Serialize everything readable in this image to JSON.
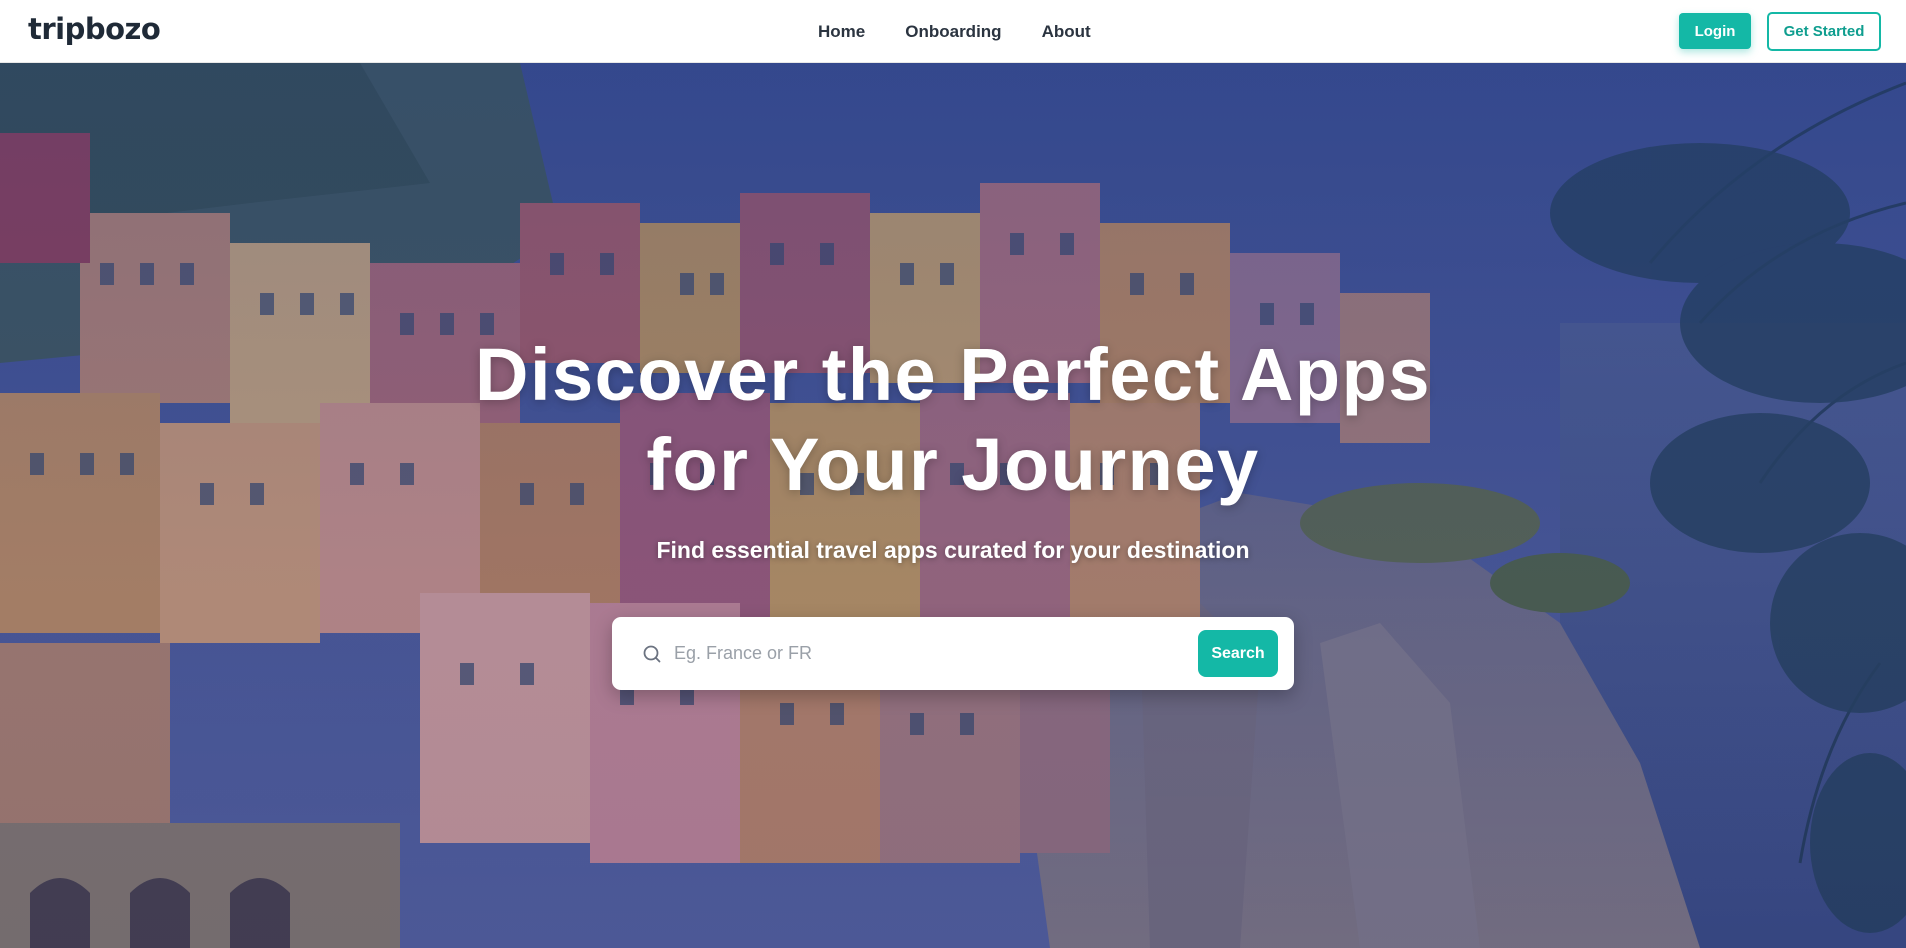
{
  "brand": {
    "name": "tripbozo"
  },
  "nav": {
    "items": [
      {
        "label": "Home"
      },
      {
        "label": "Onboarding"
      },
      {
        "label": "About"
      }
    ]
  },
  "auth": {
    "login_label": "Login",
    "get_started_label": "Get Started"
  },
  "hero": {
    "title_line1": "Discover the Perfect Apps",
    "title_line2": "for Your Journey",
    "subtitle": "Find essential travel apps curated for your destination",
    "background_image": "cinque-terre-coastal-village"
  },
  "search": {
    "placeholder": "Eg. France or FR",
    "value": "",
    "button_label": "Search",
    "icon": "search-icon"
  },
  "colors": {
    "accent": "#14b8a6",
    "text_dark": "#1f2a37",
    "hero_tint": "#3c4c8a"
  }
}
